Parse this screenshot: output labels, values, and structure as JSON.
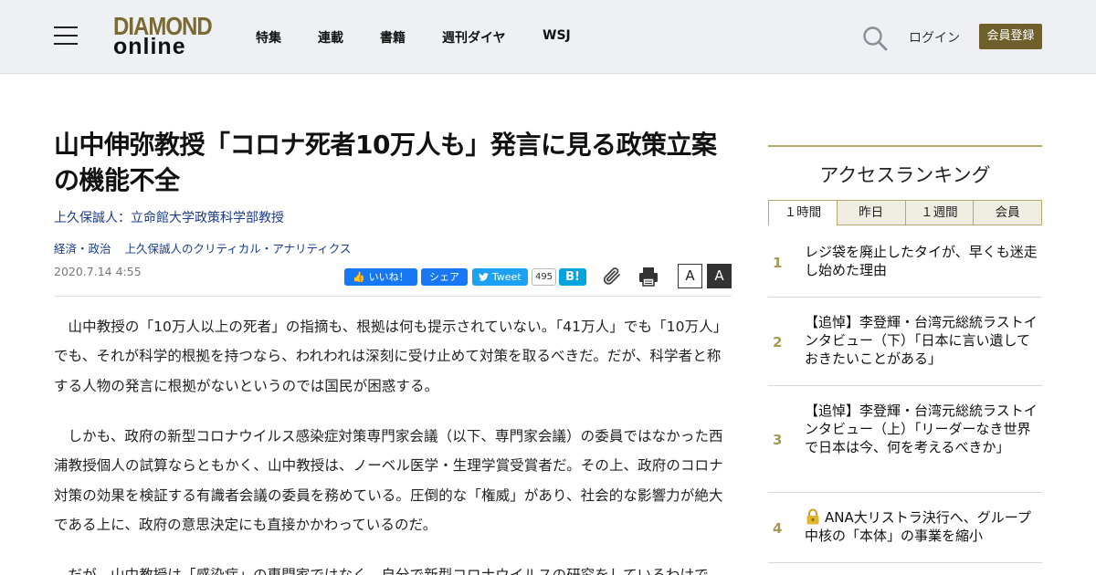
{
  "header": {
    "logo_line1": "DIAMOND",
    "logo_line2": "online",
    "nav": [
      "特集",
      "連載",
      "書籍",
      "週刊ダイヤ",
      "WSJ"
    ],
    "login": "ログイン",
    "register": "会員登録"
  },
  "article": {
    "title": "山中伸弥教授「コロナ死者10万人も」発言に見る政策立案の機能不全",
    "author": "上久保誠人：立命館大学政策科学部教授",
    "categories": [
      "経済・政治",
      "上久保誠人のクリティカル・アナリティクス"
    ],
    "date": "2020.7.14 4:55",
    "share": {
      "fb_like": "いいね！",
      "fb_share": "シェア",
      "tweet": "Tweet",
      "tweet_count": "495",
      "hatena": "B!"
    },
    "font_small": "A",
    "font_large": "A",
    "paragraphs": [
      "山中教授の「10万人以上の死者」の指摘も、根拠は何も提示されていない。「41万人」でも「10万人」でも、それが科学的根拠を持つなら、われわれは深刻に受け止めて対策を取るべきだ。だが、科学者と称する人物の発言に根拠がないというのでは国民が困惑する。",
      "しかも、政府の新型コロナウイルス感染症対策専門家会議（以下、専門家会議）の委員ではなかった西浦教授個人の試算ならともかく、山中教授は、ノーベル医学・生理学賞受賞者だ。その上、政府のコロナ対策の効果を検証する有識者会議の委員を務めている。圧倒的な「権威」があり、社会的な影響力が絶大である上に、政府の意思決定にも直接かかわっているのだ。",
      "だが、山中教授は「感染症」の専門家ではなく、自分で新型コロナウイルスの研究をしているわけで"
    ]
  },
  "sidebar": {
    "title": "アクセスランキング",
    "tabs": [
      "１時間",
      "昨日",
      "１週間",
      "会員"
    ],
    "ranking": [
      {
        "num": "1",
        "text": "レジ袋を廃止したタイが、早くも迷走し始めた理由"
      },
      {
        "num": "2",
        "text": "【追悼】李登輝・台湾元総統ラストインタビュー（下）「日本に言い遺しておきたいことがある」"
      },
      {
        "num": "3",
        "text": "【追悼】李登輝・台湾元総統ラストインタビュー（上）「リーダーなき世界で日本は今、何を考えるべきか」"
      },
      {
        "num": "4",
        "text": "ANA大リストラ決行へ、グループ中核の「本体」の事業を縮小"
      }
    ]
  },
  "colors": {
    "accent_gold": "#b8a66a",
    "register_bg": "#6e5f2b",
    "link_blue": "#1a3c8c",
    "facebook": "#1877f2",
    "twitter": "#1da1f2",
    "hatena": "#00a4de"
  }
}
